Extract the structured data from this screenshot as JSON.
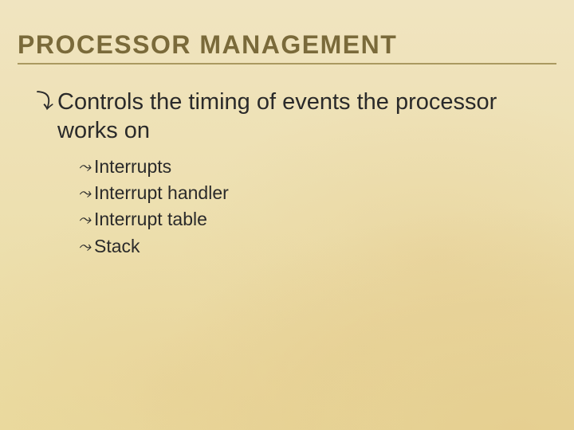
{
  "title": "PROCESSOR MANAGEMENT",
  "main_point": "Controls the timing of events the processor works on",
  "sub_points": {
    "0": "Interrupts",
    "1": "Interrupt handler",
    "2": "Interrupt table",
    "3": "Stack"
  },
  "bullets": {
    "lvl1": "໖",
    "lvl2": "๑"
  }
}
